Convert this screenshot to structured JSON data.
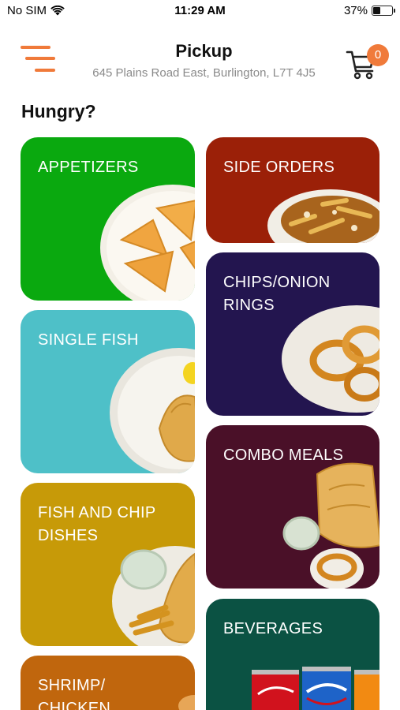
{
  "status_bar": {
    "carrier": "No SIM",
    "time": "11:29 AM",
    "battery": "37%",
    "battery_level": 0.37
  },
  "header": {
    "title": "Pickup",
    "address": "645 Plains Road East, Burlington, L7T 4J5",
    "cart_count": "0"
  },
  "section_heading": "Hungry?",
  "categories": {
    "appetizers": {
      "label": "APPETIZERS",
      "color": "#0aa90f"
    },
    "side_orders": {
      "label": "SIDE ORDERS",
      "color": "#9b2008"
    },
    "chips_onion_rings": {
      "label": "CHIPS/ONION RINGS",
      "color": "#23154f"
    },
    "single_fish": {
      "label": "SINGLE FISH",
      "color": "#4ec0c8"
    },
    "combo_meals": {
      "label": "COMBO MEALS",
      "color": "#4a1028"
    },
    "fish_and_chip_dishes": {
      "label": "FISH AND CHIP DISHES",
      "color": "#c79a08"
    },
    "beverages": {
      "label": "BEVERAGES",
      "color": "#0b5243"
    },
    "shrimp_chicken": {
      "label": "SHRIMP/ CHICKEN",
      "color": "#c0660d"
    }
  },
  "colors": {
    "accent": "#f07a3a"
  }
}
